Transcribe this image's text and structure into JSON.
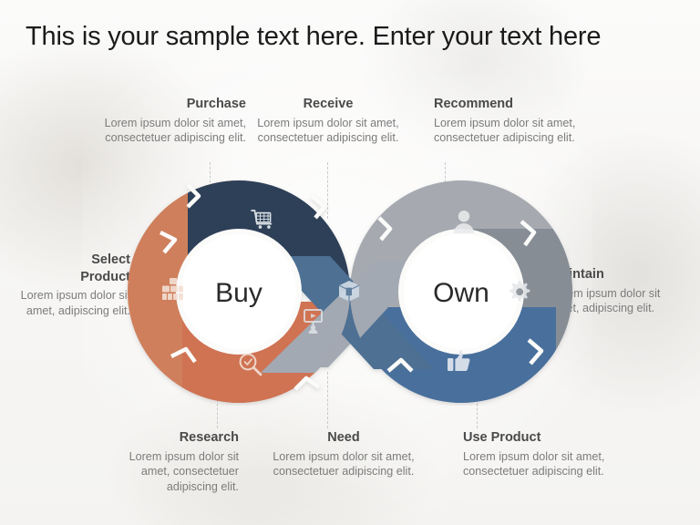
{
  "slide": {
    "title": "This is your sample text here. Enter your text here",
    "body_text": "Lorem ipsum dolor sit amet, consectetuer adipiscing elit."
  },
  "diagram": {
    "type": "infinity-loop-process",
    "hubs": [
      {
        "id": "buy",
        "label": "Buy"
      },
      {
        "id": "own",
        "label": "Own"
      }
    ],
    "colors": {
      "purchase": "#2d4158",
      "receive": "#4e7093",
      "select_product": "#cf7f5c",
      "research": "#cf7352",
      "need": "#a2a9b3",
      "recommend": "#a6aab0",
      "maintain": "#868d95",
      "use_product": "#4a6f9c",
      "hub_fill": "#ffffff",
      "separator": "#ffffff",
      "leader_line": "#c9c9c9",
      "heading_text": "#4a4a4a",
      "body_text": "#7c7c7c",
      "title_text": "#1b1b1b"
    },
    "segments": [
      {
        "id": "purchase",
        "label": "Purchase",
        "icon": "shopping-cart-icon",
        "color": "#2d4158",
        "loop": "buy",
        "position": "top"
      },
      {
        "id": "select-product",
        "label": "Select Product",
        "icon": "stacked-boxes-icon",
        "color": "#cf7f5c",
        "loop": "buy",
        "position": "left"
      },
      {
        "id": "research",
        "label": "Research",
        "icon": "magnifier-icon",
        "color": "#cf7352",
        "loop": "buy",
        "position": "bottom"
      },
      {
        "id": "receive",
        "label": "Receive",
        "icon": "package-box-icon",
        "color": "#4e7093",
        "loop": "cross",
        "position": "center-descending"
      },
      {
        "id": "need",
        "label": "Need",
        "icon": "presentation-icon",
        "color": "#a2a9b3",
        "loop": "cross",
        "position": "center-ascending"
      },
      {
        "id": "recommend",
        "label": "Recommend",
        "icon": "person-icon",
        "color": "#a6aab0",
        "loop": "own",
        "position": "top"
      },
      {
        "id": "maintain",
        "label": "Maintain",
        "icon": "gear-icon",
        "color": "#868d95",
        "loop": "own",
        "position": "right"
      },
      {
        "id": "use-product",
        "label": "Use Product",
        "icon": "thumbs-up-icon",
        "color": "#4a6f9c",
        "loop": "own",
        "position": "bottom"
      }
    ]
  },
  "callouts": {
    "purchase": {
      "heading": "Purchase",
      "body": "Lorem ipsum dolor sit amet, consectetuer adipiscing elit."
    },
    "receive": {
      "heading": "Receive",
      "body": "Lorem ipsum dolor sit amet, consectetuer adipiscing elit."
    },
    "recommend": {
      "heading": "Recommend",
      "body": "Lorem ipsum dolor sit amet, consectetuer adipiscing elit."
    },
    "select_product": {
      "heading_line1": "Select",
      "heading_line2": "Product",
      "body": "Lorem ipsum dolor sit amet, adipiscing elit."
    },
    "maintain": {
      "heading": "Maintain",
      "body": "Lorem ipsum dolor sit amet, adipiscing elit."
    },
    "research": {
      "heading": "Research",
      "body": "Lorem ipsum dolor sit amet, consectetuer adipiscing elit."
    },
    "need": {
      "heading": "Need",
      "body": "Lorem ipsum dolor sit amet, consectetuer adipiscing elit."
    },
    "use_product": {
      "heading": "Use Product",
      "body": "Lorem ipsum dolor sit amet, consectetuer adipiscing elit."
    }
  }
}
